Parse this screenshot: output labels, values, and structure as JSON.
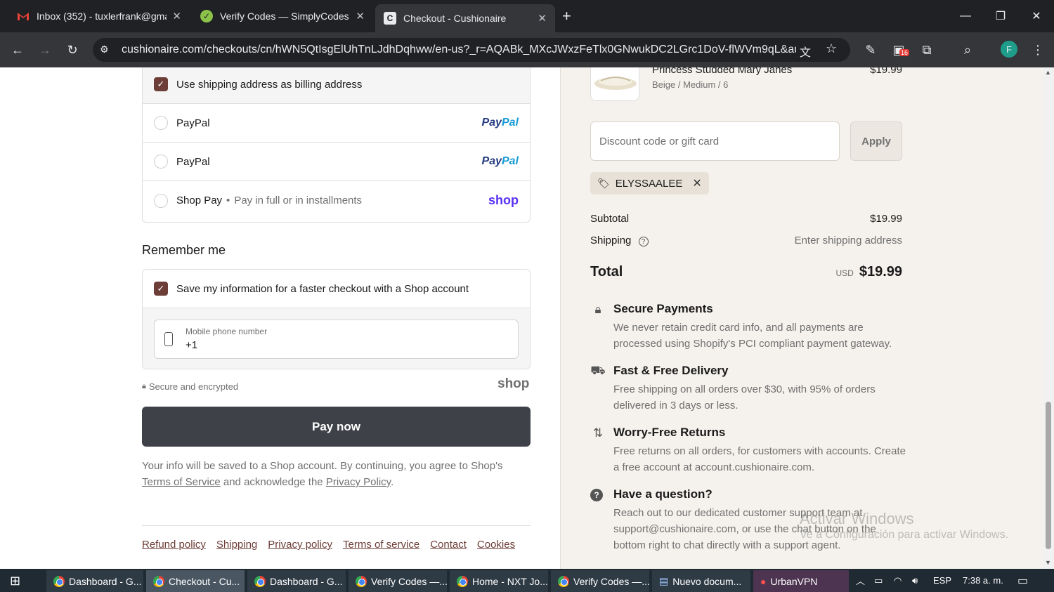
{
  "browser": {
    "tabs": [
      {
        "title": "Inbox (352) - tuxlerfrank@gmail",
        "icon": "gmail-icon"
      },
      {
        "title": "Verify Codes — SimplyCodes",
        "icon": "simplycodes-icon"
      },
      {
        "title": "Checkout - Cushionaire",
        "icon": "cushionaire-icon"
      }
    ],
    "url": "cushionaire.com/checkouts/cn/hWN5QtIsgElUhTnLJdhDqhww/en-us?_r=AQABk_MXcJWxzFeTlx0GNwukDC2LGrc1DoV-flWVm9qL&auto_re...",
    "extension_badge": "16",
    "profile_initial": "F"
  },
  "payment": {
    "billing_label": "Use shipping address as billing address",
    "options": [
      {
        "label": "PayPal",
        "logo": "PayPal"
      },
      {
        "label": "PayPal",
        "logo": "PayPal"
      },
      {
        "label": "Shop Pay",
        "sub": "Pay in full or in installments",
        "logo": "shop"
      }
    ]
  },
  "remember": {
    "heading": "Remember me",
    "save_label": "Save my information for a faster checkout with a Shop account",
    "phone_label": "Mobile phone number",
    "phone_value": "+1",
    "secure_label": "Secure and encrypted",
    "shop_logo": "shop"
  },
  "paynow_label": "Pay now",
  "disclaimer": {
    "text1": "Your info will be saved to a Shop account. By continuing, you agree to Shop's",
    "terms_link": "Terms of Service",
    "text2": "and acknowledge the",
    "privacy_link": "Privacy Policy",
    "text3": "."
  },
  "footer_links": [
    "Refund policy",
    "Shipping",
    "Privacy policy",
    "Terms of service",
    "Contact",
    "Cookies"
  ],
  "order": {
    "product_name": "Princess Studded Mary Janes",
    "product_variant": "Beige / Medium / 6",
    "product_price": "$19.99",
    "discount_placeholder": "Discount code or gift card",
    "apply_label": "Apply",
    "applied_code": "ELYSSAALEE",
    "subtotal_label": "Subtotal",
    "subtotal_value": "$19.99",
    "shipping_label": "Shipping",
    "shipping_value": "Enter shipping address",
    "total_label": "Total",
    "total_currency": "USD",
    "total_value": "$19.99"
  },
  "features": [
    {
      "title": "Secure Payments",
      "desc": "We never retain credit card info, and all payments are processed using Shopify's PCI compliant payment gateway.",
      "icon": "lock-icon"
    },
    {
      "title": "Fast & Free Delivery",
      "desc": "Free shipping on all orders over $30, with 95% of orders delivered in 3 days or less.",
      "icon": "truck-icon"
    },
    {
      "title": "Worry-Free Returns",
      "desc": "Free returns on all orders, for customers with accounts. Create a free account at account.cushionaire.com.",
      "icon": "returns-icon"
    },
    {
      "title": "Have a question?",
      "desc": "Reach out to our dedicated customer support team at support@cushionaire.com, or use the chat button on the bottom right to chat directly with a support agent.",
      "icon": "question-icon"
    }
  ],
  "watermark": {
    "line1": "Activar Windows",
    "line2": "Ve a Configuración para activar Windows."
  },
  "taskbar": {
    "apps": [
      "Dashboard - G...",
      "Checkout - Cu...",
      "Dashboard - G...",
      "Verify Codes —...",
      "Home - NXT Jo...",
      "Verify Codes —...",
      "Nuevo docum...",
      "UrbanVPN"
    ],
    "language": "ESP",
    "time": "7:38 a. m."
  }
}
